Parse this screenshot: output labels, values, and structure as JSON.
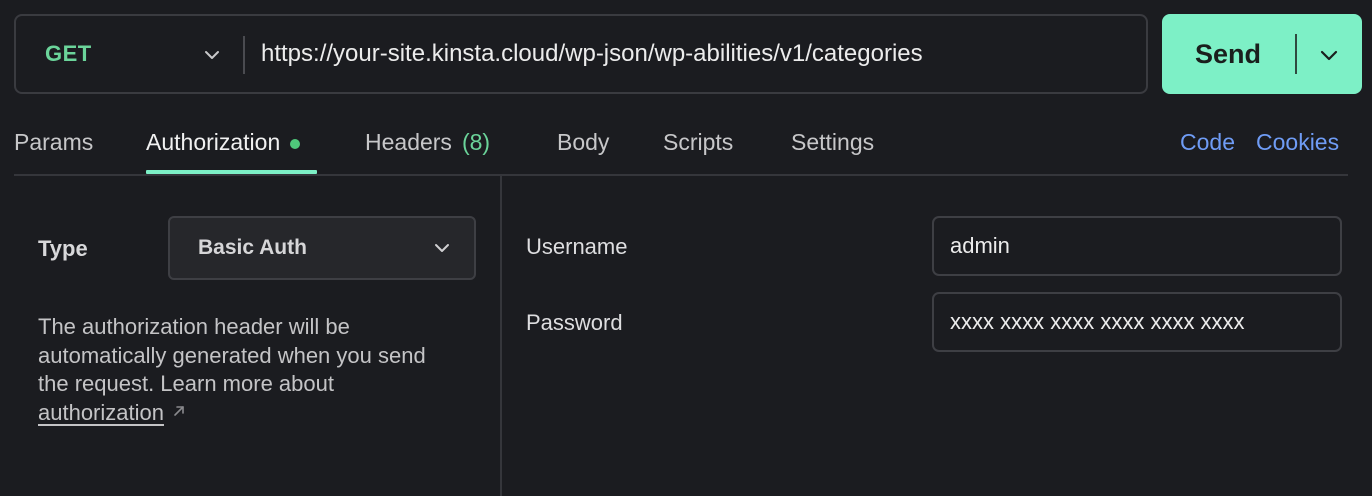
{
  "request": {
    "method": "GET",
    "url": "https://your-site.kinsta.cloud/wp-json/wp-abilities/v1/categories",
    "send_label": "Send"
  },
  "tabs": {
    "params": "Params",
    "authorization": "Authorization",
    "headers": "Headers",
    "headers_count": "(8)",
    "body": "Body",
    "scripts": "Scripts",
    "settings": "Settings",
    "code": "Code",
    "cookies": "Cookies",
    "active": "Authorization"
  },
  "auth": {
    "type_label": "Type",
    "type_value": "Basic Auth",
    "help_text": "The authorization header will be automatically generated when you send the request. Learn more about",
    "help_link": "authorization",
    "username_label": "Username",
    "username_value": "admin",
    "password_label": "Password",
    "password_value": "xxxx xxxx xxxx xxxx xxxx xxxx"
  },
  "colors": {
    "accent": "#7df0c6",
    "method_green": "#6bd49a",
    "link_blue": "#6f9cf5",
    "background": "#1b1c20"
  },
  "icons": {
    "method_dropdown": "chevron-down-icon",
    "send_dropdown": "chevron-down-icon",
    "type_dropdown": "chevron-down-icon",
    "auth_indicator": "status-dot-icon",
    "external_link": "external-link-icon"
  }
}
